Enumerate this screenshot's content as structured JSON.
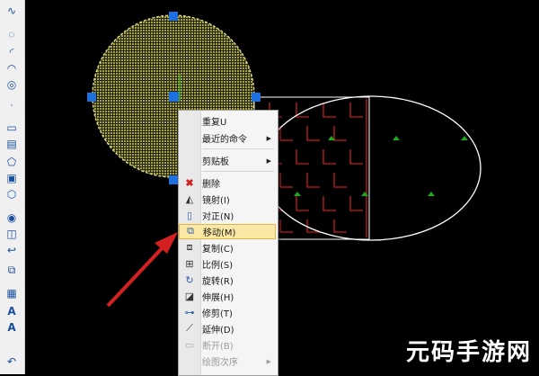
{
  "menu": {
    "items": [
      {
        "label": "重复U",
        "icon": "repeat-icon",
        "submenu": false
      },
      {
        "label": "最近的命令",
        "icon": "recent-commands-icon",
        "submenu": true
      },
      {
        "label": "剪贴板",
        "icon": "clipboard-icon",
        "submenu": true
      },
      {
        "label": "删除",
        "icon": "delete-icon",
        "submenu": false
      },
      {
        "label": "镜射(I)",
        "icon": "mirror-icon",
        "submenu": false
      },
      {
        "label": "对正(N)",
        "icon": "align-icon",
        "submenu": false
      },
      {
        "label": "移动(M)",
        "icon": "move-icon",
        "submenu": false,
        "selected": true
      },
      {
        "label": "复制(C)",
        "icon": "copy-icon",
        "submenu": false
      },
      {
        "label": "比例(S)",
        "icon": "scale-icon",
        "submenu": false
      },
      {
        "label": "旋转(R)",
        "icon": "rotate-icon",
        "submenu": false
      },
      {
        "label": "伸展(H)",
        "icon": "stretch-icon",
        "submenu": false
      },
      {
        "label": "修剪(T)",
        "icon": "trim-icon",
        "submenu": false
      },
      {
        "label": "延伸(D)",
        "icon": "extend-icon",
        "submenu": false
      },
      {
        "label": "断开(B)",
        "icon": "break-icon",
        "submenu": false,
        "disabled": true
      },
      {
        "label": "绘图次序",
        "icon": "draw-order-icon",
        "submenu": true,
        "disabled": true
      }
    ]
  },
  "toolbar": {
    "text_tool_1": "A",
    "text_tool_2": "A"
  },
  "watermark": "元码手游网",
  "colors": {
    "circle_fill": "#7a7a2a",
    "grip": "#1e6fe0",
    "hatch": "#c41e1e",
    "ellipse": "#ffffff",
    "highlight": "#fbe8a4",
    "arrow": "#d42020",
    "grass": "#1ea81e"
  }
}
